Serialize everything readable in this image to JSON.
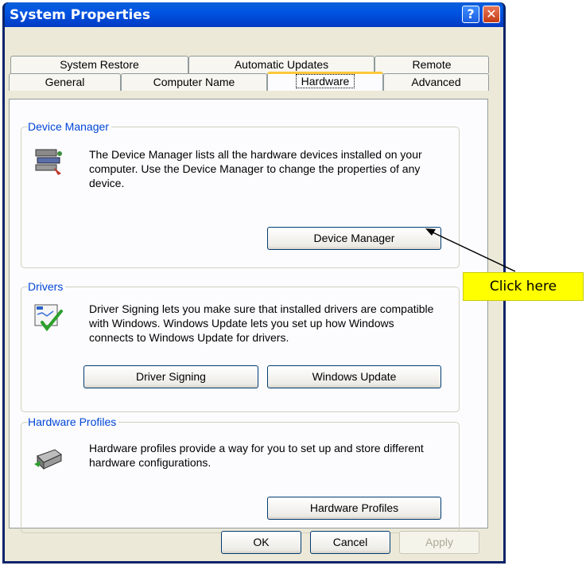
{
  "window": {
    "title": "System Properties",
    "help_glyph": "?",
    "close_glyph": "✕"
  },
  "tabs_top": [
    "System Restore",
    "Automatic Updates",
    "Remote"
  ],
  "tabs_bottom": [
    "General",
    "Computer Name",
    "Hardware",
    "Advanced"
  ],
  "active_tab": "Hardware",
  "device_manager": {
    "label": "Device Manager",
    "text": "The Device Manager lists all the hardware devices installed on your computer. Use the Device Manager to change the properties of any device.",
    "button": "Device Manager",
    "icon": "device-manager-icon"
  },
  "drivers": {
    "label": "Drivers",
    "text": "Driver Signing lets you make sure that installed drivers are compatible with Windows. Windows Update lets you set up how Windows connects to Windows Update for drivers.",
    "button_signing": "Driver Signing",
    "button_update": "Windows Update",
    "icon": "driver-signing-icon"
  },
  "hardware_profiles": {
    "label": "Hardware Profiles",
    "text": "Hardware profiles provide a way for you to set up and store different hardware configurations.",
    "button": "Hardware Profiles",
    "icon": "hardware-profiles-icon"
  },
  "footer": {
    "ok": "OK",
    "cancel": "Cancel",
    "apply": "Apply"
  },
  "annotation": {
    "callout": "Click here",
    "color": "#ffff00"
  }
}
